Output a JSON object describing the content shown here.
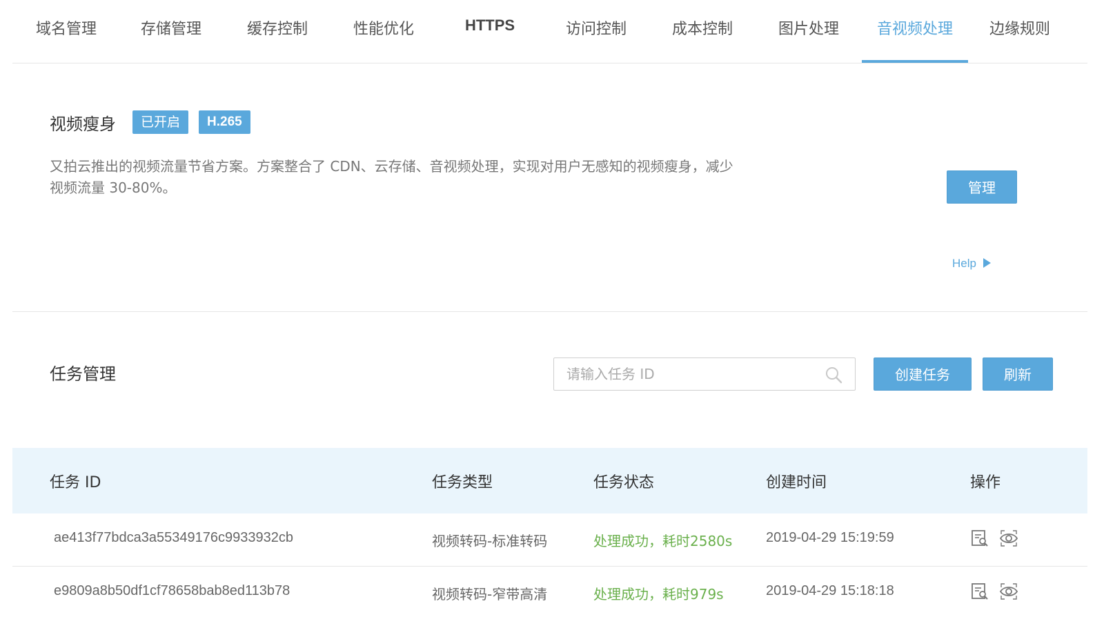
{
  "tabs": [
    {
      "label": "域名管理"
    },
    {
      "label": "存储管理"
    },
    {
      "label": "缓存控制"
    },
    {
      "label": "性能优化"
    },
    {
      "label": "HTTPS"
    },
    {
      "label": "访问控制"
    },
    {
      "label": "成本控制"
    },
    {
      "label": "图片处理"
    },
    {
      "label": "音视频处理"
    },
    {
      "label": "边缘规则"
    }
  ],
  "active_tab": "音视频处理",
  "accent_color": "#5aa8dc",
  "video_slim": {
    "title": "视频瘦身",
    "badge_status": "已开启",
    "badge_codec": "H.265",
    "description": "又拍云推出的视频流量节省方案。方案整合了 CDN、云存储、音视频处理，实现对用户无感知的视频瘦身，减少视频流量 30-80%。",
    "manage_label": "管理",
    "help_label": "Help"
  },
  "tasks": {
    "title": "任务管理",
    "search_placeholder": "请输入任务 ID",
    "create_label": "创建任务",
    "refresh_label": "刷新",
    "columns": [
      "任务 ID",
      "任务类型",
      "任务状态",
      "创建时间",
      "操作"
    ],
    "rows": [
      {
        "id": "ae413f77bdca3a55349176c9933932cb",
        "type": "视频转码-标准转码",
        "status": "处理成功，耗时2580s",
        "created": "2019-04-29 15:19:59"
      },
      {
        "id": "e9809a8b50df1cf78658bab8ed113b78",
        "type": "视频转码-窄带高清",
        "status": "处理成功，耗时979s",
        "created": "2019-04-29 15:18:18"
      }
    ],
    "status_color": "#6ab04c"
  }
}
